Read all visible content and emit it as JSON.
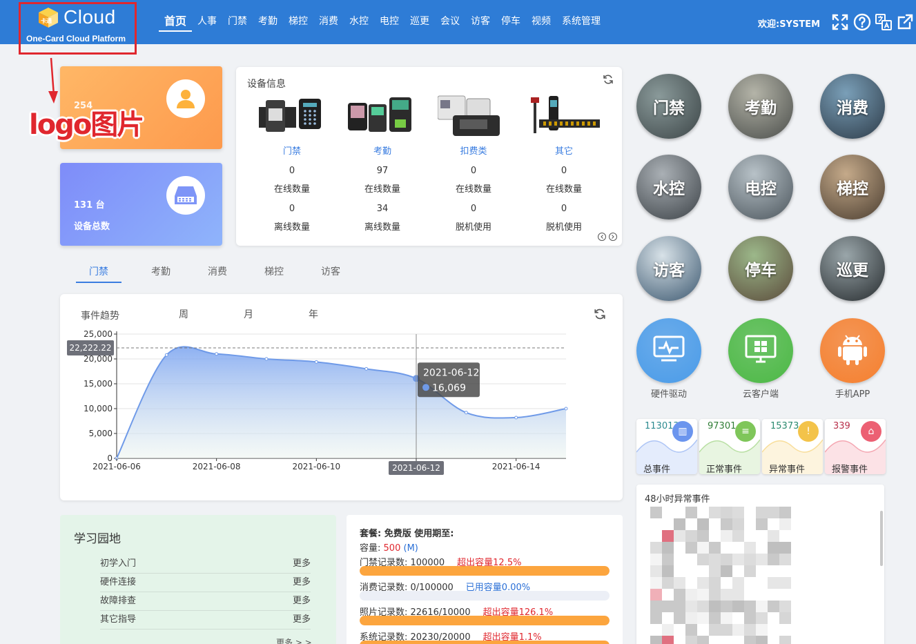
{
  "header": {
    "logo_text": "Cloud",
    "logo_sub": "One-Card Cloud Platform",
    "nav": [
      "首页",
      "人事",
      "门禁",
      "考勤",
      "梯控",
      "消费",
      "水控",
      "电控",
      "巡更",
      "会议",
      "访客",
      "停车",
      "视频",
      "系统管理"
    ],
    "active_nav": "首页",
    "welcome": "欢迎:SYSTEM",
    "icons": [
      "fullscreen-icon",
      "help-icon",
      "translate-icon",
      "external-link-icon"
    ]
  },
  "annotation": {
    "label": "logo图片",
    "color": "#e0272e"
  },
  "stat_cards": {
    "orange": {
      "value": "254"
    },
    "blue": {
      "value": "131 台",
      "label": "设备总数"
    }
  },
  "device_info": {
    "title": "设备信息",
    "columns": [
      {
        "name": "门禁",
        "v1": "0",
        "l1": "在线数量",
        "v2": "0",
        "l2": "离线数量"
      },
      {
        "name": "考勤",
        "v1": "97",
        "l1": "在线数量",
        "v2": "34",
        "l2": "离线数量"
      },
      {
        "name": "扣费类",
        "v1": "0",
        "l1": "在线数量",
        "v2": "0",
        "l2": "脱机使用"
      },
      {
        "name": "其它",
        "v1": "0",
        "l1": "在线数量",
        "v2": "0",
        "l2": "脱机使用"
      }
    ]
  },
  "tabs": [
    "门禁",
    "考勤",
    "消费",
    "梯控",
    "访客"
  ],
  "chart": {
    "title": "事件趋势",
    "periods": [
      "周",
      "月",
      "年"
    ],
    "active_period": "周"
  },
  "chart_data": {
    "type": "area",
    "title": "事件趋势",
    "x": [
      "2021-06-06",
      "2021-06-07",
      "2021-06-08",
      "2021-06-09",
      "2021-06-10",
      "2021-06-11",
      "2021-06-12",
      "2021-06-13",
      "2021-06-14",
      "2021-06-15"
    ],
    "xticks": [
      "2021-06-06",
      "2021-06-08",
      "2021-06-10",
      "2021-06-12",
      "2021-06-14"
    ],
    "series": [
      {
        "values": [
          0,
          20800,
          21000,
          20000,
          19400,
          18000,
          16069,
          9200,
          8200,
          10000
        ]
      }
    ],
    "yticks": [
      "0",
      "5,000",
      "10,000",
      "15,000",
      "20,000",
      "25,000"
    ],
    "ylim": [
      0,
      25000
    ],
    "markline": {
      "value": 22222.22,
      "label": "22,222.22"
    },
    "tooltip": {
      "date": "2021-06-12",
      "value": "16,069"
    },
    "axis_highlight": "2021-06-12",
    "color": "#6f9ae8"
  },
  "tiles": [
    {
      "label": "门禁"
    },
    {
      "label": "考勤"
    },
    {
      "label": "消费"
    },
    {
      "label": "水控"
    },
    {
      "label": "电控"
    },
    {
      "label": "梯控"
    },
    {
      "label": "访客"
    },
    {
      "label": "停车"
    },
    {
      "label": "巡更"
    }
  ],
  "apps": [
    {
      "label": "硬件驱动",
      "color": "#4a9be8"
    },
    {
      "label": "云客户端",
      "color": "#4cb845"
    },
    {
      "label": "手机APP",
      "color": "#f57f2e"
    }
  ],
  "events": [
    {
      "num": "113013",
      "label": "总事件",
      "color": "#6b95ee"
    },
    {
      "num": "97301",
      "label": "正常事件",
      "color": "#7fc65a"
    },
    {
      "num": "15373",
      "label": "异常事件",
      "color": "#f3c34a"
    },
    {
      "num": "339",
      "label": "报警事件",
      "color": "#ec6073"
    }
  ],
  "abnormal": {
    "title": "48小时异常事件"
  },
  "study": {
    "title": "学习园地",
    "rows": [
      {
        "label": "初学入门",
        "more": "更多"
      },
      {
        "label": "硬件连接",
        "more": "更多"
      },
      {
        "label": "故障排查",
        "more": "更多"
      },
      {
        "label": "其它指导",
        "more": "更多"
      }
    ],
    "more_all": "更多 > >"
  },
  "package": {
    "plan": "套餐: 免费版 使用期至:",
    "capacity_label": "容量:",
    "capacity_value": "500",
    "capacity_unit": "(M)",
    "records": [
      {
        "label": "门禁记录数: 100000",
        "status": "超出容量12.5%",
        "fill": 100,
        "over": true
      },
      {
        "label": "消费记录数: 0/100000",
        "status": "已用容量0.00%",
        "fill": 0,
        "over": false
      },
      {
        "label": "照片记录数: 22616/10000",
        "status": "超出容量126.1%",
        "fill": 100,
        "over": true
      },
      {
        "label": "系统记录数: 20230/20000",
        "status": "超出容量1.1%",
        "fill": 100,
        "over": true
      }
    ]
  }
}
